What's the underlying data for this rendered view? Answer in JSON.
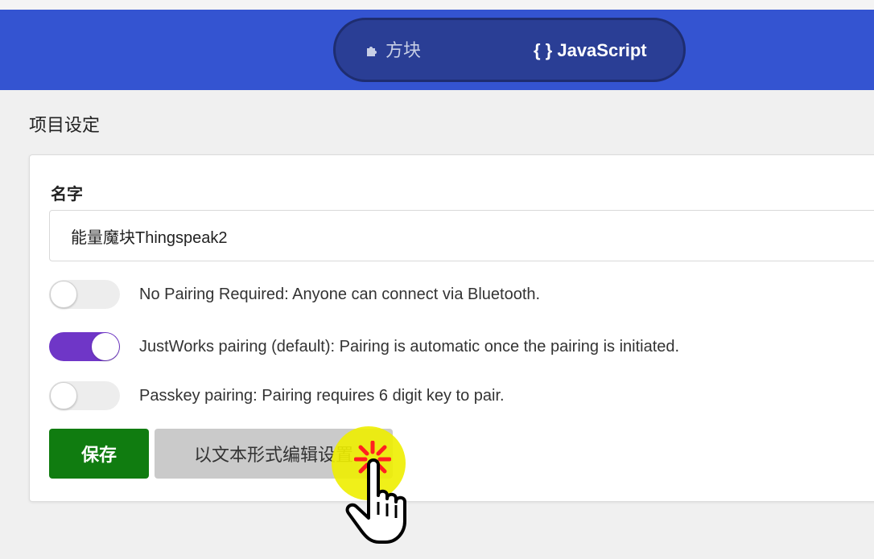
{
  "header": {
    "modes": [
      {
        "label": "方块",
        "icon": "puzzle-icon",
        "active": false
      },
      {
        "label": "{ } JavaScript",
        "icon": "",
        "active": true
      }
    ],
    "bg_color": "#3454d1"
  },
  "page": {
    "title": "项目设定"
  },
  "settings": {
    "name_label": "名字",
    "name_value": "能量魔块Thingspeak2",
    "options": [
      {
        "label": "No Pairing Required: Anyone can connect via Bluetooth.",
        "enabled": false
      },
      {
        "label": "JustWorks pairing (default): Pairing is automatic once the pairing is initiated.",
        "enabled": true
      },
      {
        "label": "Passkey pairing: Pairing requires 6 digit key to pair.",
        "enabled": false
      }
    ],
    "save_label": "保存",
    "edit_as_text_label": "以文本形式编辑设置",
    "colors": {
      "save": "#107c10",
      "toggle_on": "#6f36c7",
      "toggle_off": "#ededed"
    }
  },
  "overlay": {
    "cursor_icon": "hand-pointer-icon",
    "highlight_color": "#eeee00",
    "burst_color": "#ff2020"
  }
}
